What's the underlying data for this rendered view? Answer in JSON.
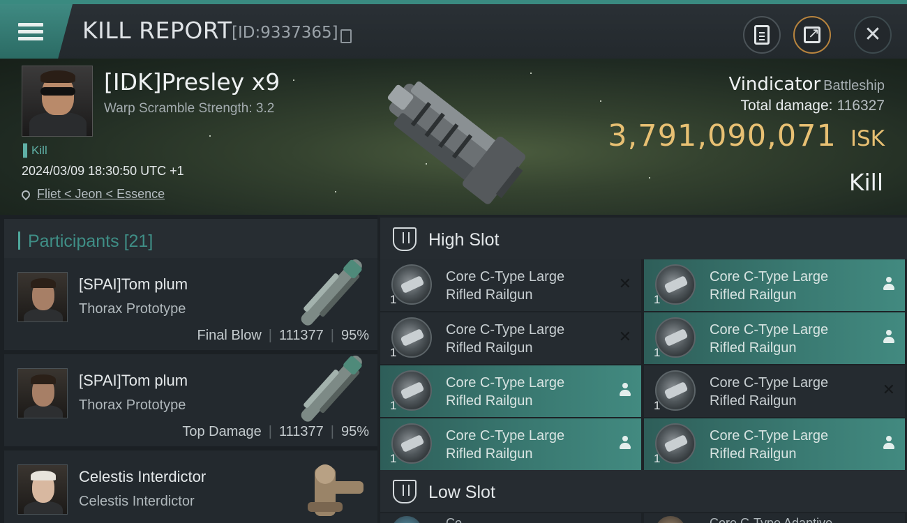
{
  "header": {
    "title": "KILL REPORT",
    "report_id": "[ID:9337365]",
    "menu_icon": "hamburger-menu-icon",
    "buttons": [
      "clipboard-icon",
      "share-icon",
      "close-icon"
    ],
    "close_glyph": "✕"
  },
  "victim": {
    "name": "[IDK]Presley x9",
    "warp_scramble": "Warp Scramble Strength: 3.2",
    "kill_tag": "Kill",
    "datetime": "2024/03/09 18:30:50 UTC +1",
    "location": "Fliet < Jeon < Essence",
    "ship_name": "Vindicator",
    "ship_class": "Battleship",
    "total_damage_label": "Total damage:",
    "total_damage_value": "116327",
    "isk_value": "3,791,090,071",
    "isk_unit": "ISK",
    "result": "Kill"
  },
  "participants": {
    "label": "Participants",
    "count": "[21]",
    "rows": [
      {
        "name": "[SPAI]Tom plum",
        "ship": "Thorax Prototype",
        "role": "Final Blow",
        "damage": "111377",
        "percent": "95%"
      },
      {
        "name": "[SPAI]Tom plum",
        "ship": "Thorax Prototype",
        "role": "Top Damage",
        "damage": "111377",
        "percent": "95%"
      },
      {
        "name": "Celestis Interdictor",
        "ship": "Celestis Interdictor",
        "role": "",
        "damage": "",
        "percent": ""
      }
    ]
  },
  "fitting": {
    "high_slot_label": "High Slot",
    "low_slot_label": "Low Slot",
    "high_slot_modules": [
      {
        "line1": "Core C-Type Large",
        "line2": "Rifled Railgun",
        "qty": "1",
        "state": "destroyed",
        "marker": "✕"
      },
      {
        "line1": "Core C-Type Large",
        "line2": "Rifled Railgun",
        "qty": "1",
        "state": "dropped",
        "marker": ""
      },
      {
        "line1": "Core C-Type Large",
        "line2": "Rifled Railgun",
        "qty": "1",
        "state": "destroyed",
        "marker": "✕"
      },
      {
        "line1": "Core C-Type Large",
        "line2": "Rifled Railgun",
        "qty": "1",
        "state": "dropped",
        "marker": ""
      },
      {
        "line1": "Core C-Type Large",
        "line2": "Rifled Railgun",
        "qty": "1",
        "state": "dropped",
        "marker": ""
      },
      {
        "line1": "Core C-Type Large",
        "line2": "Rifled Railgun",
        "qty": "1",
        "state": "destroyed",
        "marker": "✕"
      },
      {
        "line1": "Core C-Type Large",
        "line2": "Rifled Railgun",
        "qty": "1",
        "state": "dropped",
        "marker": ""
      },
      {
        "line1": "Core C-Type Large",
        "line2": "Rifled Railgun",
        "qty": "1",
        "state": "dropped",
        "marker": ""
      }
    ],
    "low_slot_partial": [
      "Co...",
      "Core C-Type Adaptive..."
    ]
  }
}
